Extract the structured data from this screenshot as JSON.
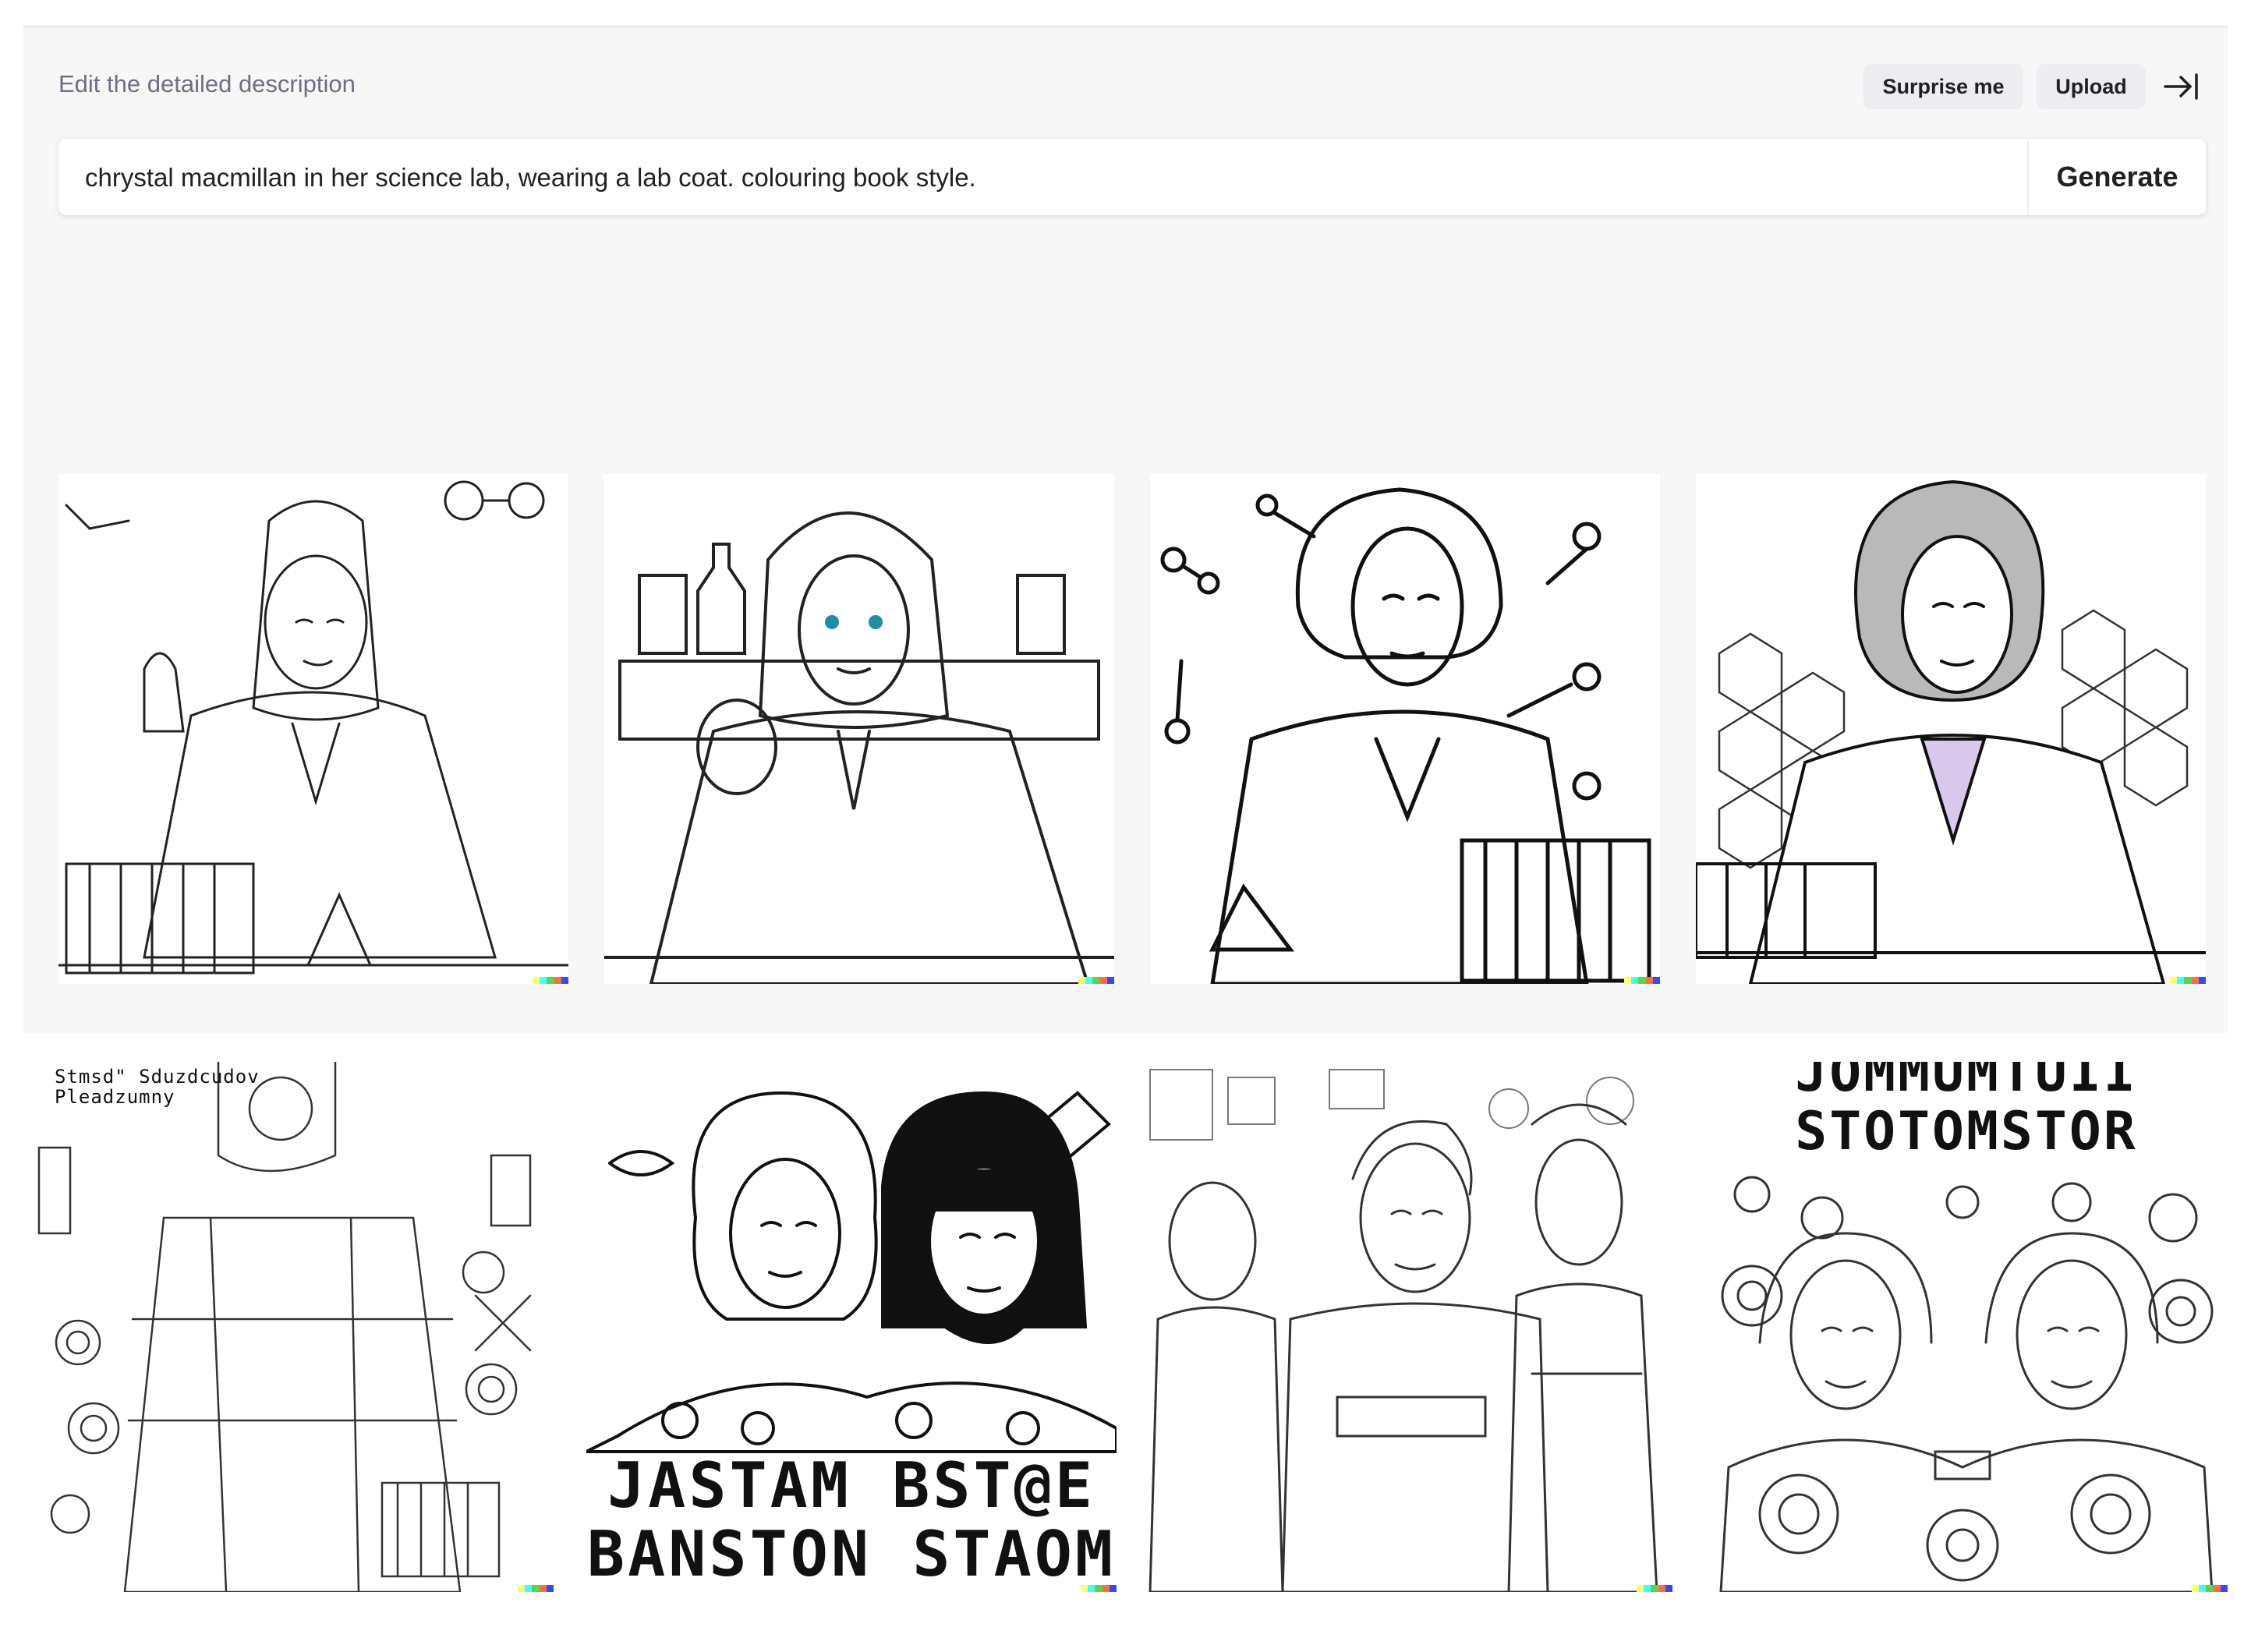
{
  "header": {
    "hint": "Edit the detailed description",
    "surprise_label": "Surprise me",
    "upload_label": "Upload"
  },
  "prompt": {
    "value": "chrystal macmillan in her science lab, wearing a lab coat. colouring book style.",
    "generate_label": "Generate"
  },
  "results_row1": [
    {
      "id": "result-1"
    },
    {
      "id": "result-2"
    },
    {
      "id": "result-3"
    },
    {
      "id": "result-4"
    }
  ],
  "results_row2": [
    {
      "id": "result-5",
      "caption": "Stmsd\" Sduzdcudov\nPleadzumny"
    },
    {
      "id": "result-6",
      "caption": "JASTAM BST@E\nBANSTON STAOM"
    },
    {
      "id": "result-7"
    },
    {
      "id": "result-8",
      "caption": "JOMMUMTUII\nSTOTOMSTOR"
    }
  ],
  "colors": {
    "panel_bg": "#f7f7f8",
    "button_bg": "#ececf1",
    "hint_text": "#6e6e80",
    "signature": [
      "#ffff66",
      "#42ffff",
      "#51da4c",
      "#ff6e3c",
      "#3c46ff"
    ]
  }
}
